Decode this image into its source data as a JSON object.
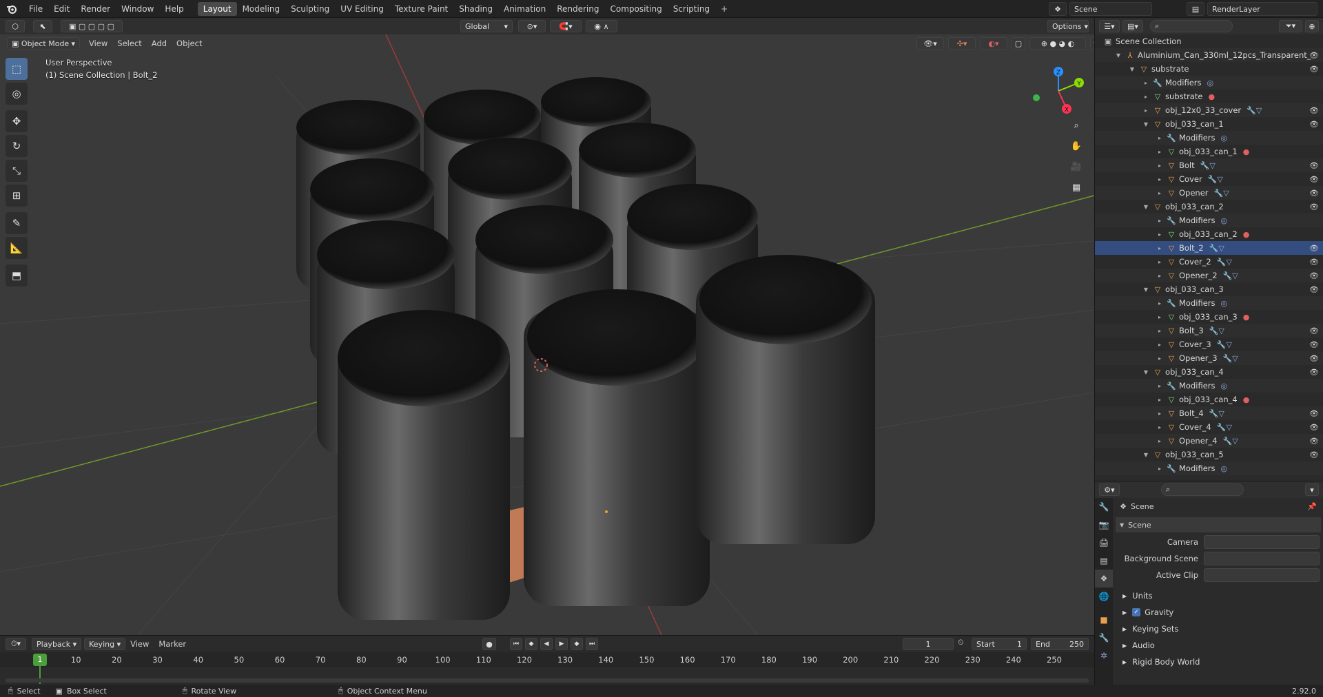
{
  "topbar": {
    "menus": [
      "File",
      "Edit",
      "Render",
      "Window",
      "Help"
    ],
    "workspaces": [
      "Layout",
      "Modeling",
      "Sculpting",
      "UV Editing",
      "Texture Paint",
      "Shading",
      "Animation",
      "Rendering",
      "Compositing",
      "Scripting"
    ],
    "active_workspace": "Layout",
    "add_tab": "+",
    "scene_name": "Scene",
    "view_layer": "RenderLayer"
  },
  "viewport_header": {
    "mode": "Object Mode",
    "menus": [
      "View",
      "Select",
      "Add",
      "Object"
    ],
    "orientation": "Global",
    "options_label": "Options"
  },
  "viewport": {
    "perspective": "User Perspective",
    "collection_info": "(1) Scene Collection | Bolt_2",
    "gizmo_axes": [
      "X",
      "Y",
      "Z"
    ]
  },
  "outliner": {
    "root": "Scene Collection",
    "rows": [
      {
        "label": "Aluminium_Can_330ml_12pcs_Transparent_",
        "indent": 1,
        "arrow": "▼",
        "icon": "empty-icon",
        "color": "#e8a050",
        "eye": true
      },
      {
        "label": "substrate",
        "indent": 2,
        "arrow": "▼",
        "icon": "object-icon",
        "color": "#e8a050",
        "eye": true
      },
      {
        "label": "Modifiers",
        "indent": 3,
        "arrow": "▸",
        "icon": "wrench-icon",
        "color": "#8fa6d6",
        "eye": false,
        "extra": "◎"
      },
      {
        "label": "substrate",
        "indent": 3,
        "arrow": "▸",
        "icon": "mesh-icon",
        "color": "#7fd67f",
        "eye": false,
        "extra": "●"
      },
      {
        "label": "obj_12x0_33_cover",
        "indent": 3,
        "arrow": "▸",
        "icon": "object-icon",
        "color": "#e8a050",
        "eye": true,
        "extra": "🔧▽"
      },
      {
        "label": "obj_033_can_1",
        "indent": 3,
        "arrow": "▼",
        "icon": "object-icon",
        "color": "#e8a050",
        "eye": true
      },
      {
        "label": "Modifiers",
        "indent": 4,
        "arrow": "▸",
        "icon": "wrench-icon",
        "color": "#8fa6d6",
        "eye": false,
        "extra": "◎"
      },
      {
        "label": "obj_033_can_1",
        "indent": 4,
        "arrow": "▸",
        "icon": "mesh-icon",
        "color": "#7fd67f",
        "eye": false,
        "extra": "●"
      },
      {
        "label": "Bolt",
        "indent": 4,
        "arrow": "▸",
        "icon": "object-icon",
        "color": "#e8a050",
        "eye": true,
        "extra": "🔧▽"
      },
      {
        "label": "Cover",
        "indent": 4,
        "arrow": "▸",
        "icon": "object-icon",
        "color": "#e8a050",
        "eye": true,
        "extra": "🔧▽"
      },
      {
        "label": "Opener",
        "indent": 4,
        "arrow": "▸",
        "icon": "object-icon",
        "color": "#e8a050",
        "eye": true,
        "extra": "🔧▽"
      },
      {
        "label": "obj_033_can_2",
        "indent": 3,
        "arrow": "▼",
        "icon": "object-icon",
        "color": "#e8a050",
        "eye": true
      },
      {
        "label": "Modifiers",
        "indent": 4,
        "arrow": "▸",
        "icon": "wrench-icon",
        "color": "#8fa6d6",
        "eye": false,
        "extra": "◎"
      },
      {
        "label": "obj_033_can_2",
        "indent": 4,
        "arrow": "▸",
        "icon": "mesh-icon",
        "color": "#7fd67f",
        "eye": false,
        "extra": "●"
      },
      {
        "label": "Bolt_2",
        "indent": 4,
        "arrow": "▸",
        "icon": "object-icon",
        "color": "#e8a050",
        "eye": true,
        "extra": "🔧▽",
        "selected": true
      },
      {
        "label": "Cover_2",
        "indent": 4,
        "arrow": "▸",
        "icon": "object-icon",
        "color": "#e8a050",
        "eye": true,
        "extra": "🔧▽"
      },
      {
        "label": "Opener_2",
        "indent": 4,
        "arrow": "▸",
        "icon": "object-icon",
        "color": "#e8a050",
        "eye": true,
        "extra": "🔧▽"
      },
      {
        "label": "obj_033_can_3",
        "indent": 3,
        "arrow": "▼",
        "icon": "object-icon",
        "color": "#e8a050",
        "eye": true
      },
      {
        "label": "Modifiers",
        "indent": 4,
        "arrow": "▸",
        "icon": "wrench-icon",
        "color": "#8fa6d6",
        "eye": false,
        "extra": "◎"
      },
      {
        "label": "obj_033_can_3",
        "indent": 4,
        "arrow": "▸",
        "icon": "mesh-icon",
        "color": "#7fd67f",
        "eye": false,
        "extra": "●"
      },
      {
        "label": "Bolt_3",
        "indent": 4,
        "arrow": "▸",
        "icon": "object-icon",
        "color": "#e8a050",
        "eye": true,
        "extra": "🔧▽"
      },
      {
        "label": "Cover_3",
        "indent": 4,
        "arrow": "▸",
        "icon": "object-icon",
        "color": "#e8a050",
        "eye": true,
        "extra": "🔧▽"
      },
      {
        "label": "Opener_3",
        "indent": 4,
        "arrow": "▸",
        "icon": "object-icon",
        "color": "#e8a050",
        "eye": true,
        "extra": "🔧▽"
      },
      {
        "label": "obj_033_can_4",
        "indent": 3,
        "arrow": "▼",
        "icon": "object-icon",
        "color": "#e8a050",
        "eye": true
      },
      {
        "label": "Modifiers",
        "indent": 4,
        "arrow": "▸",
        "icon": "wrench-icon",
        "color": "#8fa6d6",
        "eye": false,
        "extra": "◎"
      },
      {
        "label": "obj_033_can_4",
        "indent": 4,
        "arrow": "▸",
        "icon": "mesh-icon",
        "color": "#7fd67f",
        "eye": false,
        "extra": "●"
      },
      {
        "label": "Bolt_4",
        "indent": 4,
        "arrow": "▸",
        "icon": "object-icon",
        "color": "#e8a050",
        "eye": true,
        "extra": "🔧▽"
      },
      {
        "label": "Cover_4",
        "indent": 4,
        "arrow": "▸",
        "icon": "object-icon",
        "color": "#e8a050",
        "eye": true,
        "extra": "🔧▽"
      },
      {
        "label": "Opener_4",
        "indent": 4,
        "arrow": "▸",
        "icon": "object-icon",
        "color": "#e8a050",
        "eye": true,
        "extra": "🔧▽"
      },
      {
        "label": "obj_033_can_5",
        "indent": 3,
        "arrow": "▼",
        "icon": "object-icon",
        "color": "#e8a050",
        "eye": true
      },
      {
        "label": "Modifiers",
        "indent": 4,
        "arrow": "▸",
        "icon": "wrench-icon",
        "color": "#8fa6d6",
        "eye": false,
        "extra": "◎"
      }
    ]
  },
  "properties": {
    "context": "Scene",
    "panel": "Scene",
    "fields": {
      "camera": "Camera",
      "background_scene": "Background Scene",
      "active_clip": "Active Clip"
    },
    "sections": [
      "Units",
      "Gravity",
      "Keying Sets",
      "Audio",
      "Rigid Body World"
    ],
    "gravity_checked": true
  },
  "timeline": {
    "menus": [
      "Playback",
      "Keying",
      "View",
      "Marker"
    ],
    "current_frame": "1",
    "start_label": "Start",
    "start": "1",
    "end_label": "End",
    "end": "250",
    "ticks": [
      "10",
      "20",
      "30",
      "40",
      "50",
      "60",
      "70",
      "80",
      "90",
      "100",
      "110",
      "120",
      "130",
      "140",
      "150",
      "160",
      "170",
      "180",
      "190",
      "200",
      "210",
      "220",
      "230",
      "240",
      "250"
    ],
    "playhead_label": "1"
  },
  "statusbar": {
    "select": "Select",
    "box_select": "Box Select",
    "rotate_view": "Rotate View",
    "context_menu": "Object Context Menu",
    "version": "2.92.0"
  },
  "colors": {
    "accent": "#4772b3",
    "selected_row": "#334d80",
    "x_axis": "#ff3352",
    "y_axis": "#8bdc00",
    "z_axis": "#2890ff"
  }
}
